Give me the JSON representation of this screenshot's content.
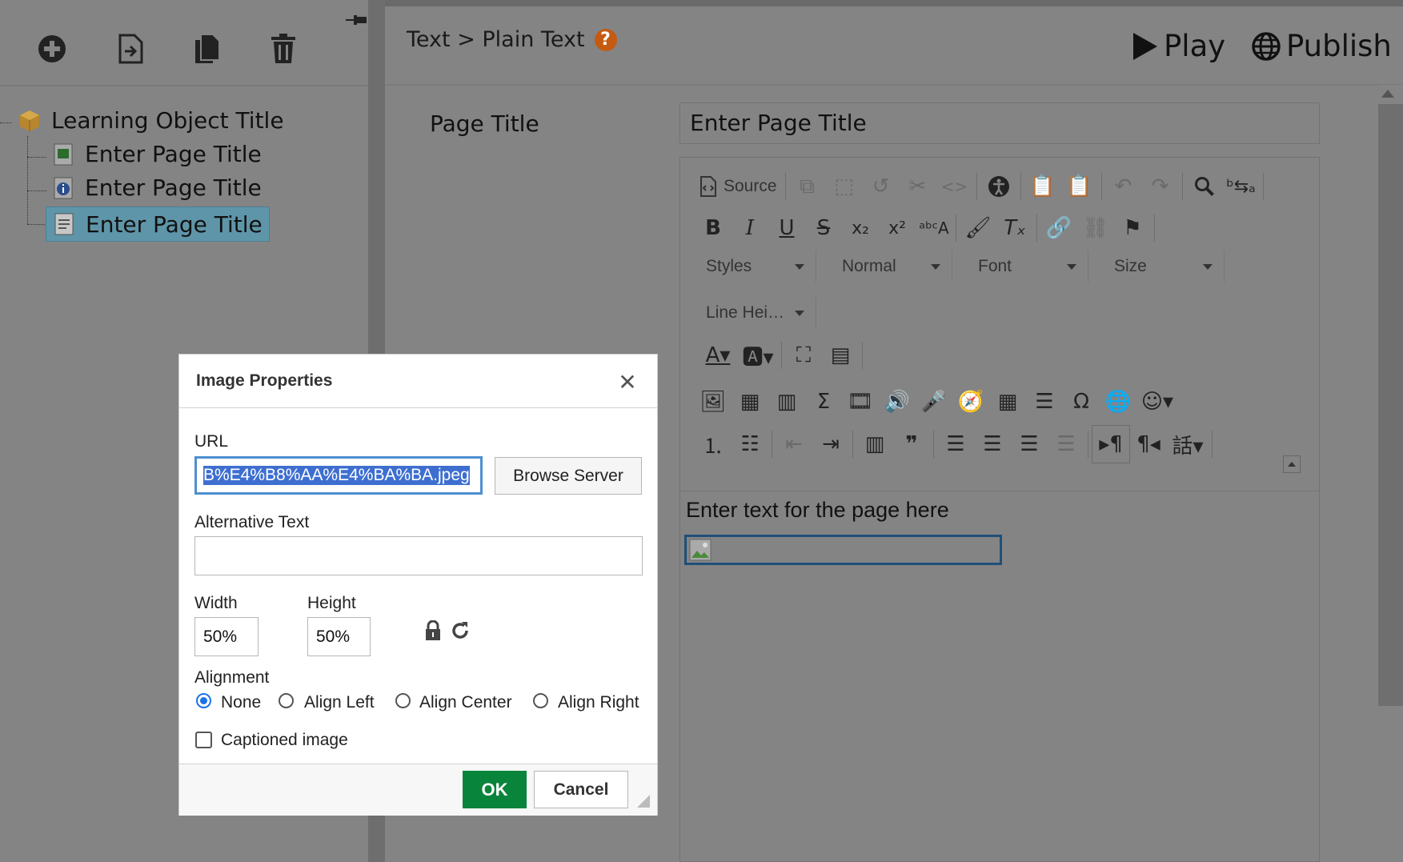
{
  "left_toolbar": {
    "icons": [
      "add-icon",
      "import-page-icon",
      "duplicate-icon",
      "delete-icon",
      "pin-icon"
    ]
  },
  "tree": {
    "root": {
      "label": "Learning Object Title",
      "icon": "package-icon"
    },
    "children": [
      {
        "label": "Enter Page Title",
        "icon": "media-page-icon"
      },
      {
        "label": "Enter Page Title",
        "icon": "info-page-icon"
      },
      {
        "label": "Enter Page Title",
        "icon": "text-page-icon",
        "selected": true
      }
    ]
  },
  "header": {
    "breadcrumb": "Text > Plain Text",
    "help_icon": "?",
    "play_label": "Play",
    "publish_label": "Publish"
  },
  "page_title": {
    "label": "Page Title",
    "value": "Enter Page Title"
  },
  "editor": {
    "source_label": "Source",
    "combos": {
      "styles": "Styles",
      "format": "Normal",
      "font": "Font",
      "size": "Size",
      "line_height": "Line Hei…"
    },
    "content_text": "Enter text for the page here"
  },
  "dialog": {
    "title": "Image Properties",
    "close_glyph": "✕",
    "url_label": "URL",
    "url_value": "B%E4%B8%AA%E4%BA%BA.jpeg",
    "browse_label": "Browse Server",
    "alt_label": "Alternative Text",
    "alt_value": "",
    "width_label": "Width",
    "width_value": "50%",
    "height_label": "Height",
    "height_value": "50%",
    "alignment_label": "Alignment",
    "alignment_options": [
      "None",
      "Align Left",
      "Align Center",
      "Align Right"
    ],
    "alignment_selected": "None",
    "caption_label": "Captioned image",
    "caption_checked": false,
    "ok_label": "OK",
    "cancel_label": "Cancel"
  },
  "colors": {
    "overlay_gray": "#848484",
    "ok_green": "#09843b",
    "selection_blue": "#3e6fd0",
    "help_orange": "#c55a11"
  }
}
